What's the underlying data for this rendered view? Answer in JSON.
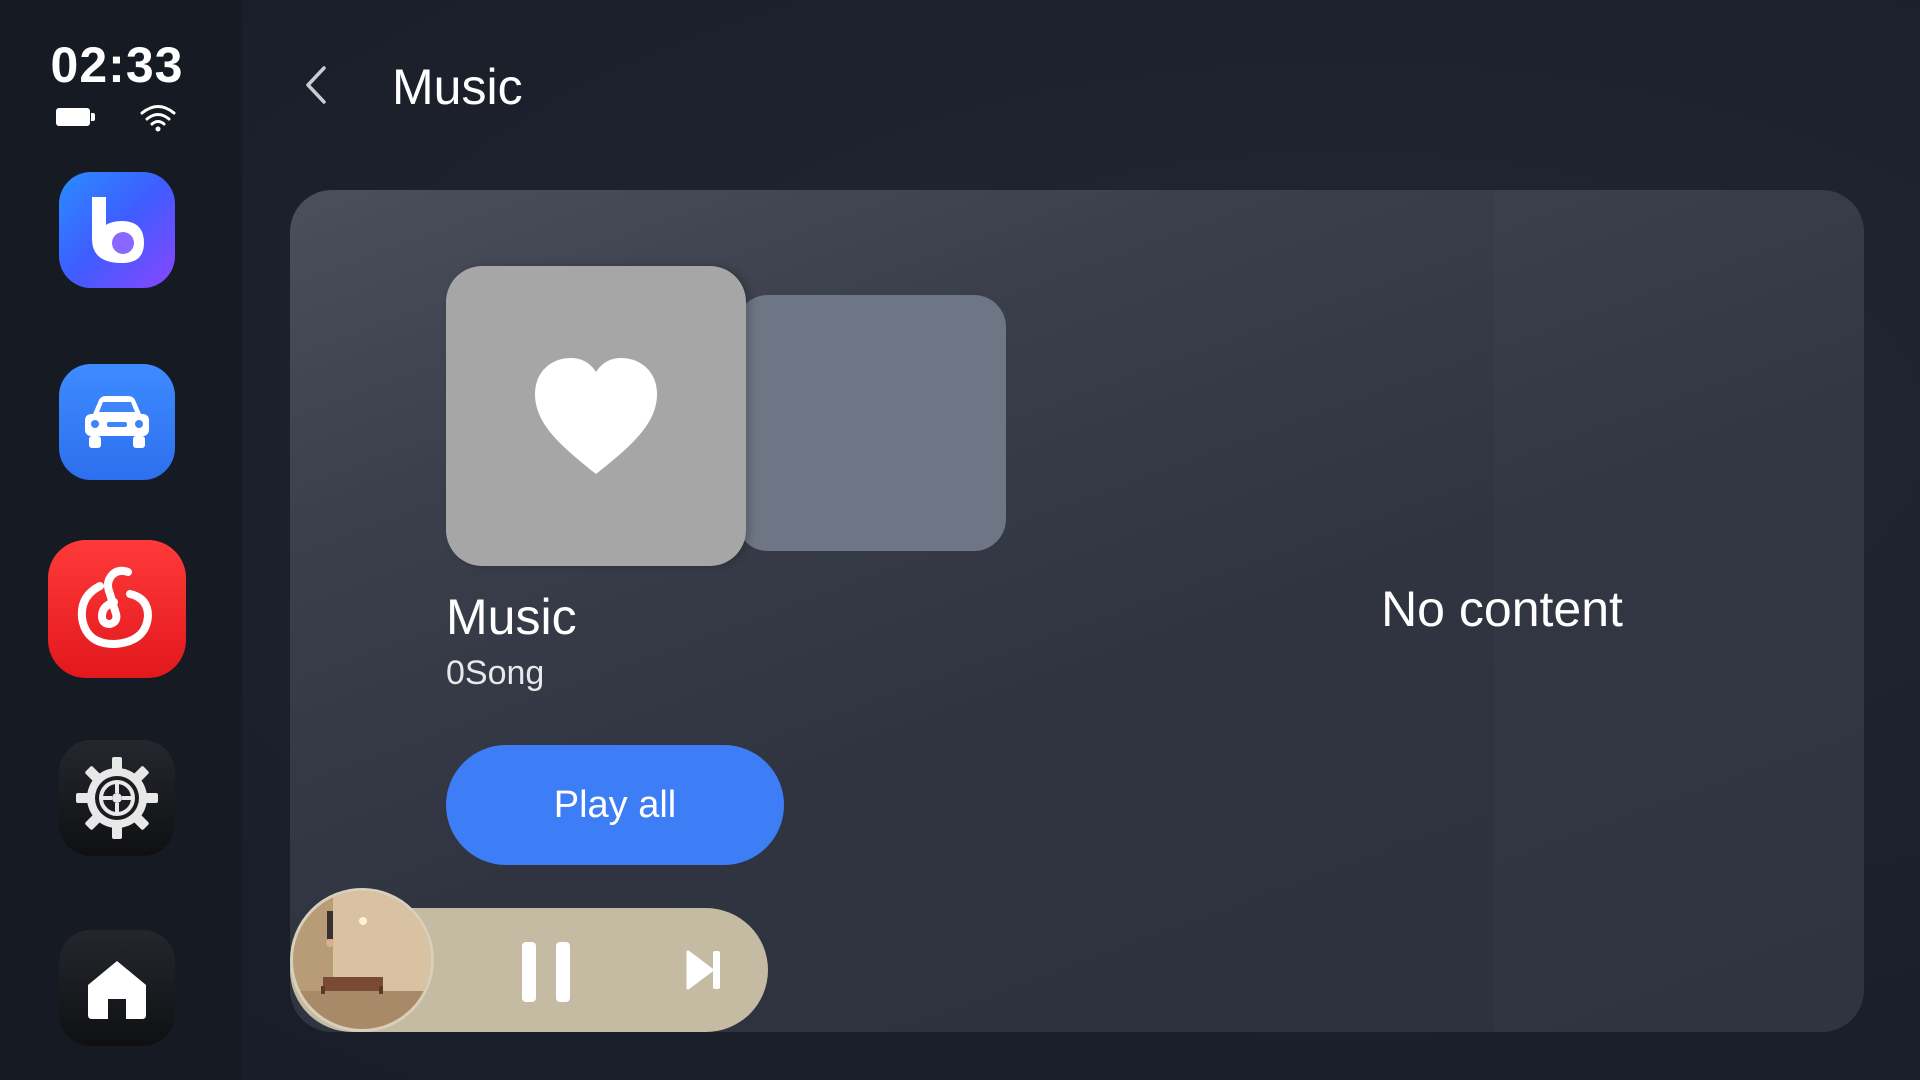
{
  "status": {
    "time": "02:33",
    "battery_icon": "battery-icon",
    "wifi_icon": "wifi-icon"
  },
  "dock": {
    "apps": [
      {
        "name": "assistant",
        "icon": "assistant-icon"
      },
      {
        "name": "car",
        "icon": "car-icon"
      },
      {
        "name": "netease-music",
        "icon": "netease-music-icon"
      },
      {
        "name": "settings",
        "icon": "settings-icon"
      },
      {
        "name": "home",
        "icon": "home-icon"
      }
    ]
  },
  "header": {
    "back_icon": "chevron-left-icon",
    "title": "Music"
  },
  "playlist": {
    "cover_icon": "heart-icon",
    "name": "Music",
    "song_count": "0Song",
    "play_all_label": "Play all"
  },
  "content": {
    "empty_text": "No content"
  },
  "mini_player": {
    "state": "playing",
    "pause_icon": "pause-icon",
    "next_icon": "skip-next-icon"
  },
  "colors": {
    "accent": "#3d7df5",
    "mini_player_bg": "#c5bba2",
    "netease_red": "#e2181c"
  }
}
